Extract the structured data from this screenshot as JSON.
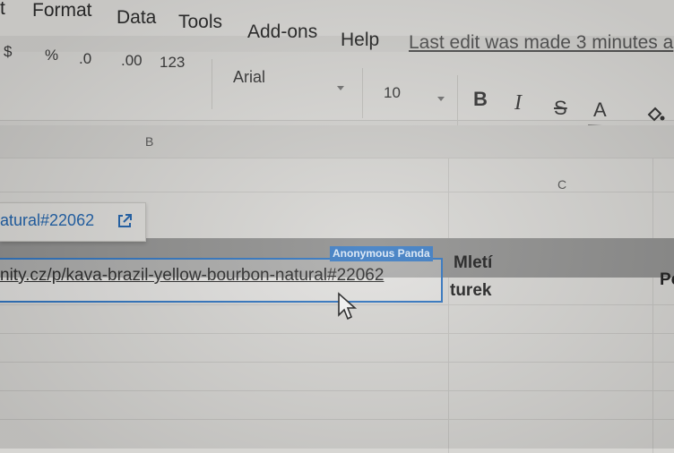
{
  "menu": {
    "items": [
      {
        "label": "t",
        "name": "menu-partial"
      },
      {
        "label": "Format",
        "name": "menu-format"
      },
      {
        "label": "Data",
        "name": "menu-data"
      },
      {
        "label": "Tools",
        "name": "menu-tools"
      },
      {
        "label": "Add-ons",
        "name": "menu-addons"
      },
      {
        "label": "Help",
        "name": "menu-help"
      }
    ],
    "last_edit": "Last edit was made 3 minutes a"
  },
  "toolbar": {
    "currency": "$",
    "percent": "%",
    "decrease_decimal": ".0",
    "increase_decimal": ".00",
    "number_format": "123",
    "font_family": "Arial",
    "font_size": "10",
    "bold": "B",
    "italic": "I",
    "strike": "S",
    "text_color": "A"
  },
  "grid": {
    "columns": [
      "B",
      "C"
    ],
    "link_preview": "atural#22062",
    "selected_cell_value": "nity.cz/p/kava-brazil-yellow-bourbon-natural#22062",
    "collaborator": "Anonymous Panda",
    "header_c": "Mletí",
    "header_d_partial": "Po",
    "cell_c": "turek"
  },
  "colors": {
    "selection": "#2f74c0",
    "link": "#1d5fa8",
    "header_band": "#8f8f8e"
  }
}
